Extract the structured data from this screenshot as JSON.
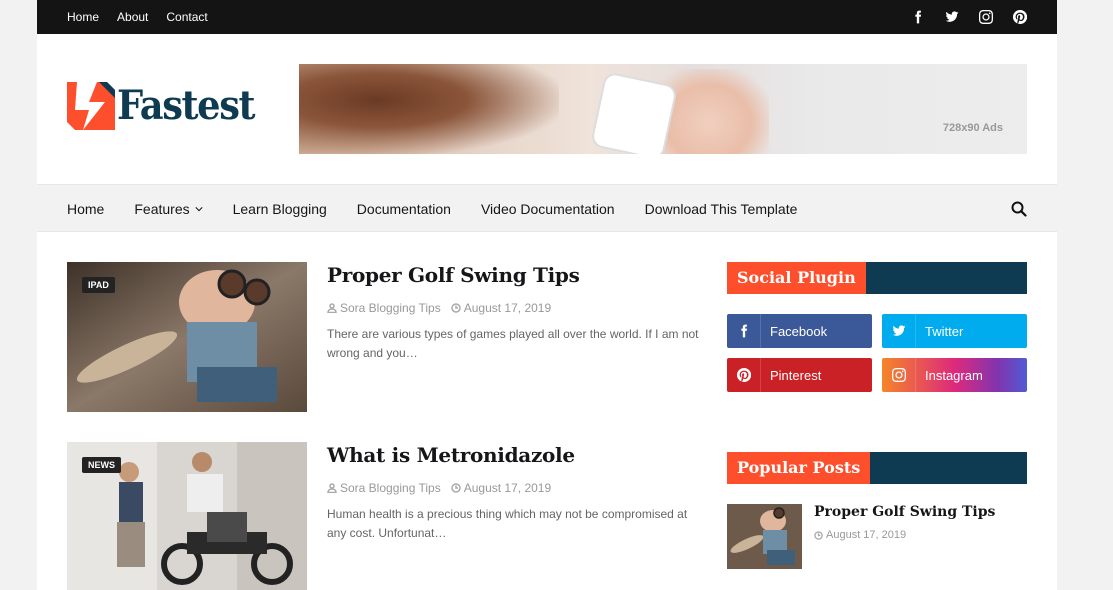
{
  "topbar": {
    "links": [
      "Home",
      "About",
      "Contact"
    ],
    "social_icons": [
      "facebook-icon",
      "twitter-icon",
      "instagram-icon",
      "pinterest-icon"
    ]
  },
  "header": {
    "logo_text": "Fastest",
    "ad_label": "728x90 Ads"
  },
  "nav": {
    "items": [
      "Home",
      "Features",
      "Learn Blogging",
      "Documentation",
      "Video Documentation",
      "Download This Template"
    ],
    "dropdown_item": "Features"
  },
  "posts": [
    {
      "tag": "IPAD",
      "title": "Proper Golf Swing Tips",
      "author": "Sora Blogging Tips",
      "date": "August 17, 2019",
      "snippet": "There are various types of games played all over the world. If I am not wrong and you…"
    },
    {
      "tag": "NEWS",
      "title": "What is Metronidazole",
      "author": "Sora Blogging Tips",
      "date": "August 17, 2019",
      "snippet": "Human health is a precious thing which may not be compromised at any cost. Unfortunat…"
    }
  ],
  "sidebar": {
    "social_title": "Social Plugin",
    "social_buttons": [
      {
        "label": "Facebook",
        "icon": "facebook-icon",
        "color": "#3b5999"
      },
      {
        "label": "Twitter",
        "icon": "twitter-icon",
        "color": "#00acee"
      },
      {
        "label": "Pinterest",
        "icon": "pinterest-icon",
        "color": "#ca2127"
      },
      {
        "label": "Instagram",
        "icon": "instagram-icon",
        "color": "#c13584"
      }
    ],
    "popular_title": "Popular Posts",
    "popular": [
      {
        "title": "Proper Golf Swing Tips",
        "date": "August 17, 2019"
      }
    ]
  },
  "colors": {
    "accent": "#fe4f2d",
    "dark": "#0e3a52",
    "topbar": "#141414"
  }
}
